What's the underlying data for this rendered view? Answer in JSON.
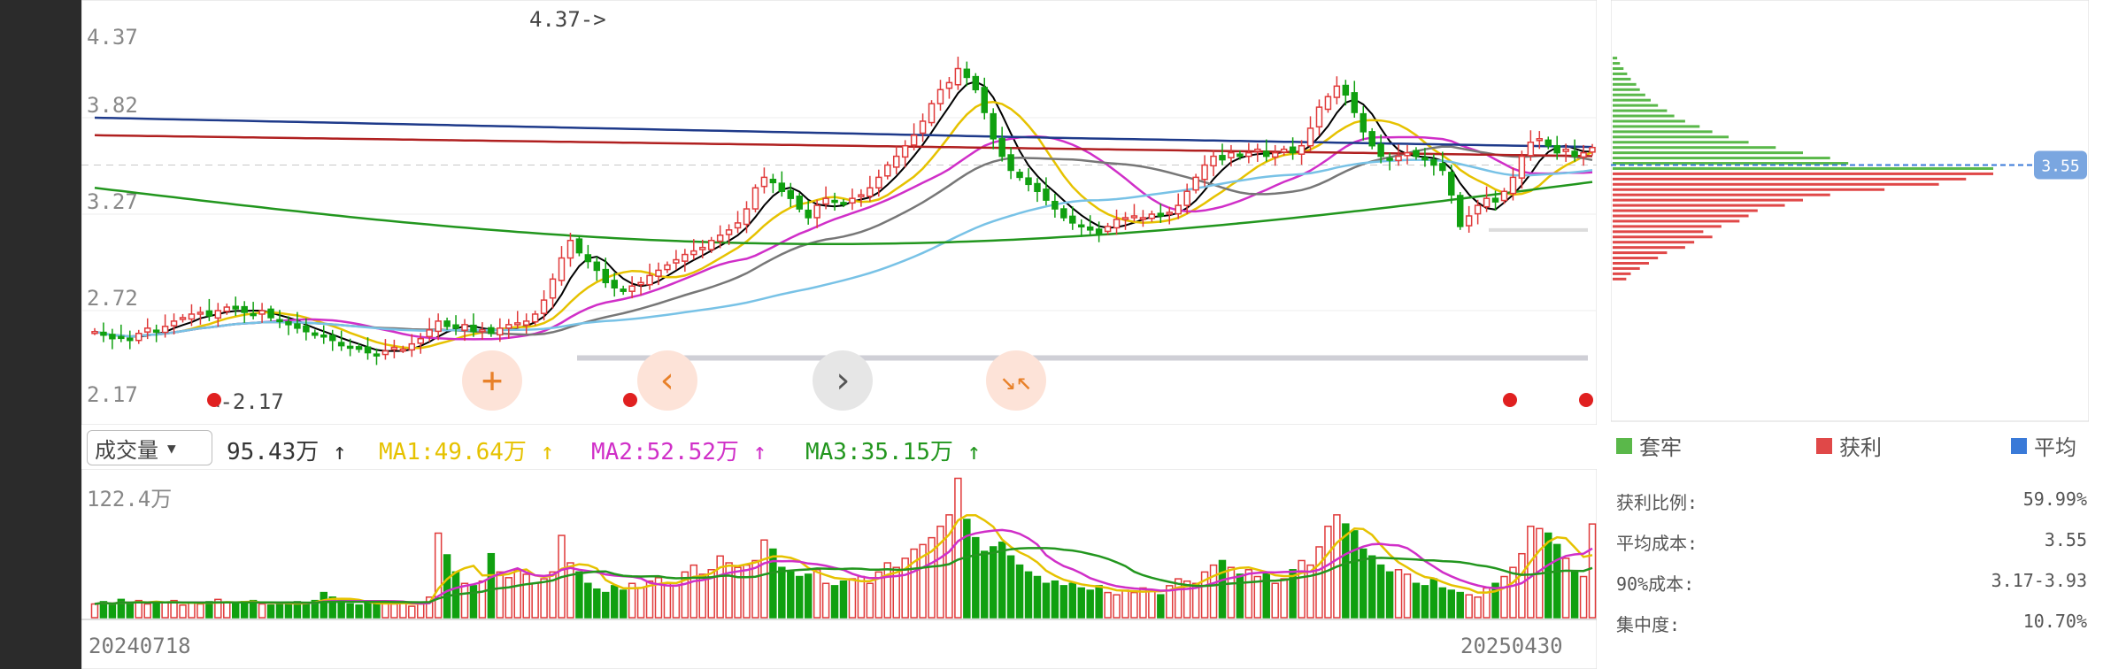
{
  "colors": {
    "up": "#e03a3a",
    "down": "#10a010",
    "ma5": "#000000",
    "ma10": "#e6c200",
    "ma20": "#d02fc8",
    "ma30": "#777777",
    "ma60": "#78c2e6",
    "ma120": "#22961e",
    "ma250": "#b02020",
    "ma500": "#1e3a8a",
    "trapped": "#5ab84a",
    "profit": "#e04848",
    "avg": "#3a7ad8"
  },
  "icons": {
    "zoom_in": "plus-icon",
    "prev": "chevron-left-icon",
    "next": "chevron-right-icon",
    "zoom_fit": "shrink-icon",
    "dropdown": "triangle-down-icon"
  },
  "indicator": {
    "select_label": "成交量",
    "volume": "95.43万 ↑",
    "ma1": "MA1:49.64万 ↑",
    "ma2": "MA2:52.52万 ↑",
    "ma3": "MA3:35.15万 ↑"
  },
  "chip": {
    "avg_cost_tag": "3.55",
    "legend": {
      "trapped": "套牢",
      "profit": "获利",
      "avg": "平均"
    },
    "stats": [
      {
        "label": "获利比例:",
        "value": "59.99%"
      },
      {
        "label": "平均成本:",
        "value": "3.55"
      },
      {
        "label": "90%成本:",
        "value": "3.17-3.93"
      },
      {
        "label": "集中度:",
        "value": "10.70%"
      }
    ]
  },
  "dates": {
    "start": "20240718",
    "end": "20250430"
  },
  "chart_data": [
    {
      "type": "candlestick",
      "ytick_labels": [
        "4.37",
        "3.82",
        "3.27",
        "2.72",
        "2.17"
      ],
      "ylim": [
        2.17,
        4.37
      ],
      "annotations": {
        "high": "4.37->",
        "low": "<-2.17"
      },
      "x": [
        "20240718",
        "20250430"
      ],
      "close": [
        2.6,
        2.58,
        2.56,
        2.57,
        2.55,
        2.59,
        2.62,
        2.6,
        2.63,
        2.66,
        2.68,
        2.7,
        2.71,
        2.69,
        2.72,
        2.74,
        2.73,
        2.71,
        2.7,
        2.72,
        2.68,
        2.66,
        2.64,
        2.62,
        2.6,
        2.58,
        2.57,
        2.55,
        2.52,
        2.51,
        2.5,
        2.48,
        2.47,
        2.49,
        2.51,
        2.5,
        2.53,
        2.56,
        2.61,
        2.66,
        2.63,
        2.62,
        2.64,
        2.6,
        2.61,
        2.59,
        2.62,
        2.64,
        2.65,
        2.66,
        2.7,
        2.78,
        2.9,
        3.02,
        3.12,
        3.05,
        3.0,
        2.95,
        2.88,
        2.85,
        2.83,
        2.86,
        2.88,
        2.92,
        2.95,
        2.98,
        3.01,
        3.04,
        3.06,
        3.08,
        3.12,
        3.15,
        3.18,
        3.22,
        3.3,
        3.42,
        3.48,
        3.45,
        3.4,
        3.36,
        3.3,
        3.25,
        3.32,
        3.36,
        3.34,
        3.33,
        3.36,
        3.38,
        3.42,
        3.48,
        3.55,
        3.6,
        3.66,
        3.72,
        3.8,
        3.9,
        3.98,
        4.02,
        4.1,
        4.05,
        3.98,
        3.85,
        3.7,
        3.6,
        3.52,
        3.48,
        3.44,
        3.4,
        3.35,
        3.3,
        3.25,
        3.22,
        3.2,
        3.18,
        3.16,
        3.2,
        3.24,
        3.25,
        3.26,
        3.25,
        3.27,
        3.26,
        3.28,
        3.32,
        3.4,
        3.48,
        3.55,
        3.6,
        3.58,
        3.62,
        3.6,
        3.62,
        3.64,
        3.6,
        3.62,
        3.64,
        3.62,
        3.66,
        3.76,
        3.88,
        3.94,
        4.0,
        3.95,
        3.85,
        3.74,
        3.66,
        3.6,
        3.58,
        3.6,
        3.62,
        3.6,
        3.58,
        3.55,
        3.52,
        3.38,
        3.2,
        3.26,
        3.32,
        3.36,
        3.34,
        3.4,
        3.48,
        3.6,
        3.68,
        3.7,
        3.66,
        3.62,
        3.64,
        3.6,
        3.62,
        3.65
      ],
      "ma_keys": [
        "ma5",
        "ma10",
        "ma20",
        "ma30",
        "ma60",
        "ma120",
        "ma250",
        "ma500"
      ]
    },
    {
      "type": "bar",
      "ytick_labels": [
        "122.4万"
      ],
      "ylim": [
        0,
        122.4
      ],
      "values": [
        12,
        14,
        11,
        16,
        13,
        15,
        12,
        14,
        13,
        15,
        11,
        13,
        12,
        14,
        16,
        13,
        12,
        14,
        15,
        12,
        11,
        13,
        12,
        14,
        13,
        15,
        22,
        18,
        15,
        12,
        11,
        13,
        12,
        14,
        12,
        13,
        10,
        12,
        18,
        74,
        55,
        40,
        30,
        28,
        32,
        56,
        40,
        35,
        42,
        38,
        30,
        34,
        40,
        72,
        48,
        40,
        30,
        25,
        22,
        28,
        24,
        30,
        26,
        32,
        35,
        30,
        28,
        40,
        46,
        38,
        42,
        54,
        48,
        44,
        46,
        50,
        68,
        60,
        44,
        40,
        36,
        38,
        42,
        30,
        28,
        32,
        34,
        36,
        30,
        40,
        48,
        44,
        52,
        60,
        64,
        70,
        80,
        90,
        122,
        86,
        70,
        58,
        62,
        66,
        54,
        46,
        40,
        36,
        30,
        32,
        28,
        30,
        26,
        24,
        28,
        22,
        20,
        24,
        22,
        26,
        24,
        20,
        28,
        34,
        32,
        30,
        40,
        46,
        50,
        44,
        38,
        42,
        36,
        40,
        30,
        34,
        42,
        50,
        46,
        62,
        80,
        90,
        82,
        76,
        60,
        54,
        46,
        40,
        42,
        38,
        30,
        28,
        34,
        26,
        24,
        22,
        20,
        18,
        26,
        30,
        36,
        44,
        56,
        80,
        78,
        74,
        64,
        52,
        40,
        36,
        82
      ],
      "series": [
        {
          "name": "MA1",
          "key": "ma1"
        },
        {
          "name": "MA2",
          "key": "ma2"
        },
        {
          "name": "MA3",
          "key": "ma3"
        }
      ]
    },
    {
      "type": "bar",
      "orientation": "horizontal",
      "ylim": [
        2.17,
        4.37
      ],
      "avg_price": 3.55,
      "levels": [
        4.16,
        4.13,
        4.1,
        4.07,
        4.04,
        4.01,
        3.98,
        3.95,
        3.92,
        3.89,
        3.86,
        3.83,
        3.8,
        3.77,
        3.74,
        3.71,
        3.68,
        3.65,
        3.62,
        3.59,
        3.56,
        3.53,
        3.5,
        3.47,
        3.44,
        3.41,
        3.38,
        3.35,
        3.32,
        3.29,
        3.26,
        3.23,
        3.2,
        3.17,
        3.14,
        3.11,
        3.08,
        3.05,
        3.02,
        2.99,
        2.96,
        2.93,
        2.9
      ],
      "trapped": [
        5,
        8,
        12,
        16,
        20,
        26,
        30,
        36,
        42,
        50,
        60,
        68,
        80,
        96,
        110,
        128,
        150,
        180,
        210,
        240,
        260,
        420,
        0,
        0,
        0,
        0,
        0,
        0,
        0,
        0,
        0,
        0,
        0,
        0,
        0,
        0,
        0,
        0,
        0,
        0,
        0,
        0,
        0
      ],
      "profit": [
        0,
        0,
        0,
        0,
        0,
        0,
        0,
        0,
        0,
        0,
        0,
        0,
        0,
        0,
        0,
        0,
        0,
        0,
        0,
        0,
        0,
        0,
        420,
        390,
        360,
        300,
        240,
        210,
        190,
        160,
        150,
        140,
        120,
        100,
        110,
        90,
        80,
        60,
        50,
        40,
        30,
        20,
        15
      ]
    }
  ]
}
